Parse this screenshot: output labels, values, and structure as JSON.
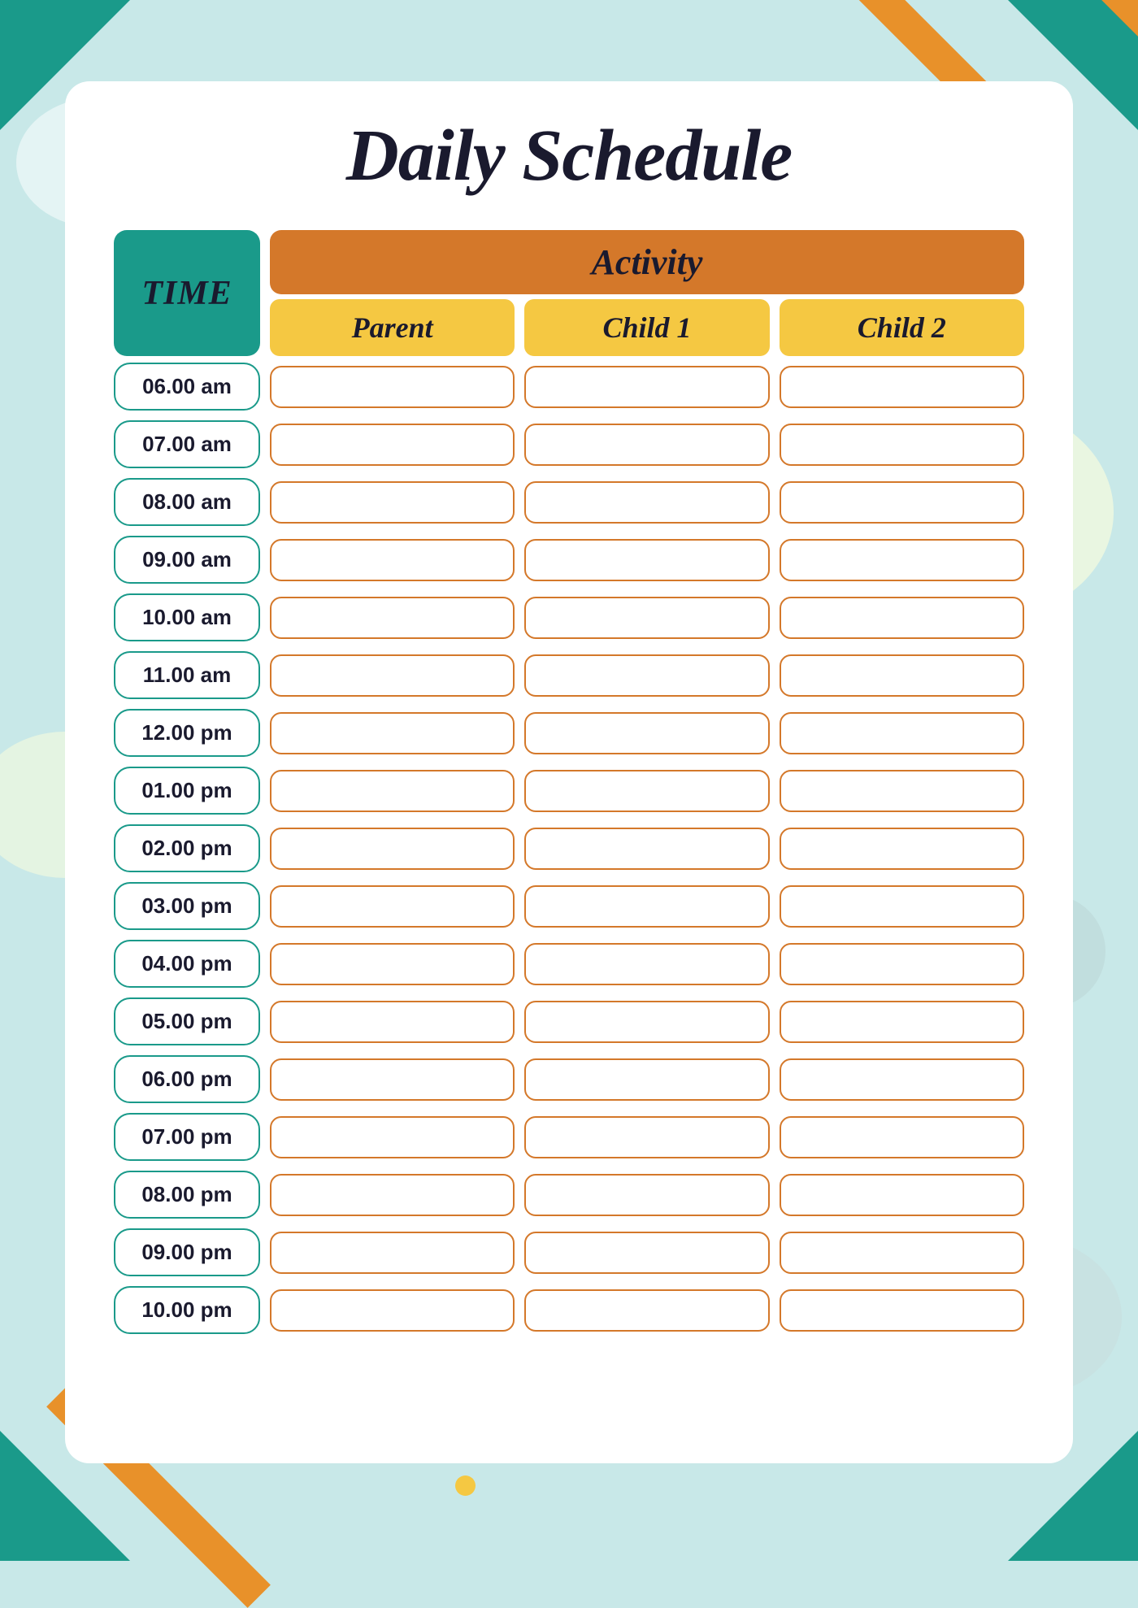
{
  "page": {
    "title": "Daily Schedule",
    "background_color": "#c8e8e8"
  },
  "header": {
    "time_label": "TIME",
    "activity_label": "Activity",
    "columns": [
      {
        "id": "parent",
        "label": "Parent"
      },
      {
        "id": "child1",
        "label": "Child 1"
      },
      {
        "id": "child2",
        "label": "Child 2"
      }
    ]
  },
  "time_slots": [
    "06.00 am",
    "07.00 am",
    "08.00 am",
    "09.00 am",
    "10.00 am",
    "11.00 am",
    "12.00 pm",
    "01.00 pm",
    "02.00 pm",
    "03.00 pm",
    "04.00 pm",
    "05.00 pm",
    "06.00 pm",
    "07.00 pm",
    "08.00 pm",
    "09.00 pm",
    "10.00 pm"
  ]
}
